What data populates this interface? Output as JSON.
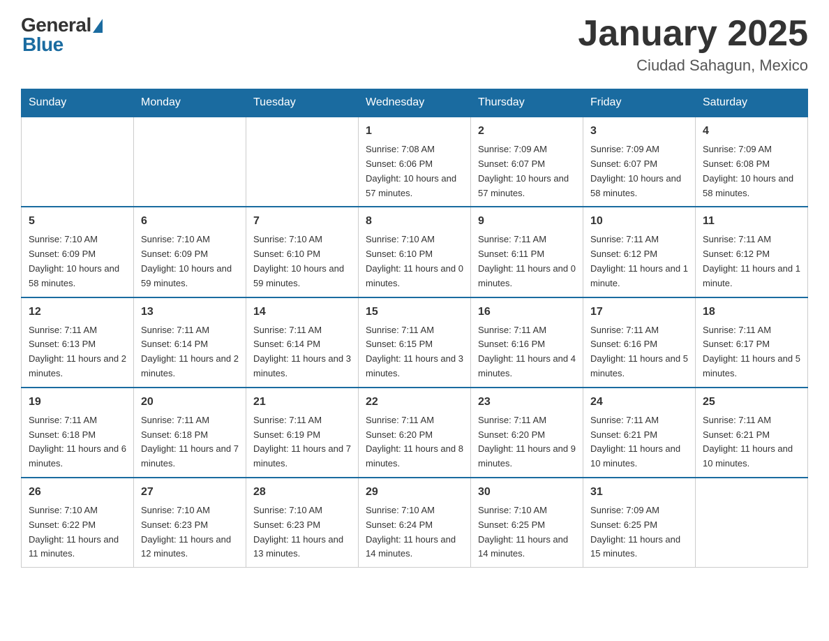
{
  "header": {
    "logo_general": "General",
    "logo_blue": "Blue",
    "title": "January 2025",
    "subtitle": "Ciudad Sahagun, Mexico"
  },
  "days_of_week": [
    "Sunday",
    "Monday",
    "Tuesday",
    "Wednesday",
    "Thursday",
    "Friday",
    "Saturday"
  ],
  "weeks": [
    [
      {
        "day": "",
        "sunrise": "",
        "sunset": "",
        "daylight": ""
      },
      {
        "day": "",
        "sunrise": "",
        "sunset": "",
        "daylight": ""
      },
      {
        "day": "",
        "sunrise": "",
        "sunset": "",
        "daylight": ""
      },
      {
        "day": "1",
        "sunrise": "Sunrise: 7:08 AM",
        "sunset": "Sunset: 6:06 PM",
        "daylight": "Daylight: 10 hours and 57 minutes."
      },
      {
        "day": "2",
        "sunrise": "Sunrise: 7:09 AM",
        "sunset": "Sunset: 6:07 PM",
        "daylight": "Daylight: 10 hours and 57 minutes."
      },
      {
        "day": "3",
        "sunrise": "Sunrise: 7:09 AM",
        "sunset": "Sunset: 6:07 PM",
        "daylight": "Daylight: 10 hours and 58 minutes."
      },
      {
        "day": "4",
        "sunrise": "Sunrise: 7:09 AM",
        "sunset": "Sunset: 6:08 PM",
        "daylight": "Daylight: 10 hours and 58 minutes."
      }
    ],
    [
      {
        "day": "5",
        "sunrise": "Sunrise: 7:10 AM",
        "sunset": "Sunset: 6:09 PM",
        "daylight": "Daylight: 10 hours and 58 minutes."
      },
      {
        "day": "6",
        "sunrise": "Sunrise: 7:10 AM",
        "sunset": "Sunset: 6:09 PM",
        "daylight": "Daylight: 10 hours and 59 minutes."
      },
      {
        "day": "7",
        "sunrise": "Sunrise: 7:10 AM",
        "sunset": "Sunset: 6:10 PM",
        "daylight": "Daylight: 10 hours and 59 minutes."
      },
      {
        "day": "8",
        "sunrise": "Sunrise: 7:10 AM",
        "sunset": "Sunset: 6:10 PM",
        "daylight": "Daylight: 11 hours and 0 minutes."
      },
      {
        "day": "9",
        "sunrise": "Sunrise: 7:11 AM",
        "sunset": "Sunset: 6:11 PM",
        "daylight": "Daylight: 11 hours and 0 minutes."
      },
      {
        "day": "10",
        "sunrise": "Sunrise: 7:11 AM",
        "sunset": "Sunset: 6:12 PM",
        "daylight": "Daylight: 11 hours and 1 minute."
      },
      {
        "day": "11",
        "sunrise": "Sunrise: 7:11 AM",
        "sunset": "Sunset: 6:12 PM",
        "daylight": "Daylight: 11 hours and 1 minute."
      }
    ],
    [
      {
        "day": "12",
        "sunrise": "Sunrise: 7:11 AM",
        "sunset": "Sunset: 6:13 PM",
        "daylight": "Daylight: 11 hours and 2 minutes."
      },
      {
        "day": "13",
        "sunrise": "Sunrise: 7:11 AM",
        "sunset": "Sunset: 6:14 PM",
        "daylight": "Daylight: 11 hours and 2 minutes."
      },
      {
        "day": "14",
        "sunrise": "Sunrise: 7:11 AM",
        "sunset": "Sunset: 6:14 PM",
        "daylight": "Daylight: 11 hours and 3 minutes."
      },
      {
        "day": "15",
        "sunrise": "Sunrise: 7:11 AM",
        "sunset": "Sunset: 6:15 PM",
        "daylight": "Daylight: 11 hours and 3 minutes."
      },
      {
        "day": "16",
        "sunrise": "Sunrise: 7:11 AM",
        "sunset": "Sunset: 6:16 PM",
        "daylight": "Daylight: 11 hours and 4 minutes."
      },
      {
        "day": "17",
        "sunrise": "Sunrise: 7:11 AM",
        "sunset": "Sunset: 6:16 PM",
        "daylight": "Daylight: 11 hours and 5 minutes."
      },
      {
        "day": "18",
        "sunrise": "Sunrise: 7:11 AM",
        "sunset": "Sunset: 6:17 PM",
        "daylight": "Daylight: 11 hours and 5 minutes."
      }
    ],
    [
      {
        "day": "19",
        "sunrise": "Sunrise: 7:11 AM",
        "sunset": "Sunset: 6:18 PM",
        "daylight": "Daylight: 11 hours and 6 minutes."
      },
      {
        "day": "20",
        "sunrise": "Sunrise: 7:11 AM",
        "sunset": "Sunset: 6:18 PM",
        "daylight": "Daylight: 11 hours and 7 minutes."
      },
      {
        "day": "21",
        "sunrise": "Sunrise: 7:11 AM",
        "sunset": "Sunset: 6:19 PM",
        "daylight": "Daylight: 11 hours and 7 minutes."
      },
      {
        "day": "22",
        "sunrise": "Sunrise: 7:11 AM",
        "sunset": "Sunset: 6:20 PM",
        "daylight": "Daylight: 11 hours and 8 minutes."
      },
      {
        "day": "23",
        "sunrise": "Sunrise: 7:11 AM",
        "sunset": "Sunset: 6:20 PM",
        "daylight": "Daylight: 11 hours and 9 minutes."
      },
      {
        "day": "24",
        "sunrise": "Sunrise: 7:11 AM",
        "sunset": "Sunset: 6:21 PM",
        "daylight": "Daylight: 11 hours and 10 minutes."
      },
      {
        "day": "25",
        "sunrise": "Sunrise: 7:11 AM",
        "sunset": "Sunset: 6:21 PM",
        "daylight": "Daylight: 11 hours and 10 minutes."
      }
    ],
    [
      {
        "day": "26",
        "sunrise": "Sunrise: 7:10 AM",
        "sunset": "Sunset: 6:22 PM",
        "daylight": "Daylight: 11 hours and 11 minutes."
      },
      {
        "day": "27",
        "sunrise": "Sunrise: 7:10 AM",
        "sunset": "Sunset: 6:23 PM",
        "daylight": "Daylight: 11 hours and 12 minutes."
      },
      {
        "day": "28",
        "sunrise": "Sunrise: 7:10 AM",
        "sunset": "Sunset: 6:23 PM",
        "daylight": "Daylight: 11 hours and 13 minutes."
      },
      {
        "day": "29",
        "sunrise": "Sunrise: 7:10 AM",
        "sunset": "Sunset: 6:24 PM",
        "daylight": "Daylight: 11 hours and 14 minutes."
      },
      {
        "day": "30",
        "sunrise": "Sunrise: 7:10 AM",
        "sunset": "Sunset: 6:25 PM",
        "daylight": "Daylight: 11 hours and 14 minutes."
      },
      {
        "day": "31",
        "sunrise": "Sunrise: 7:09 AM",
        "sunset": "Sunset: 6:25 PM",
        "daylight": "Daylight: 11 hours and 15 minutes."
      },
      {
        "day": "",
        "sunrise": "",
        "sunset": "",
        "daylight": ""
      }
    ]
  ]
}
